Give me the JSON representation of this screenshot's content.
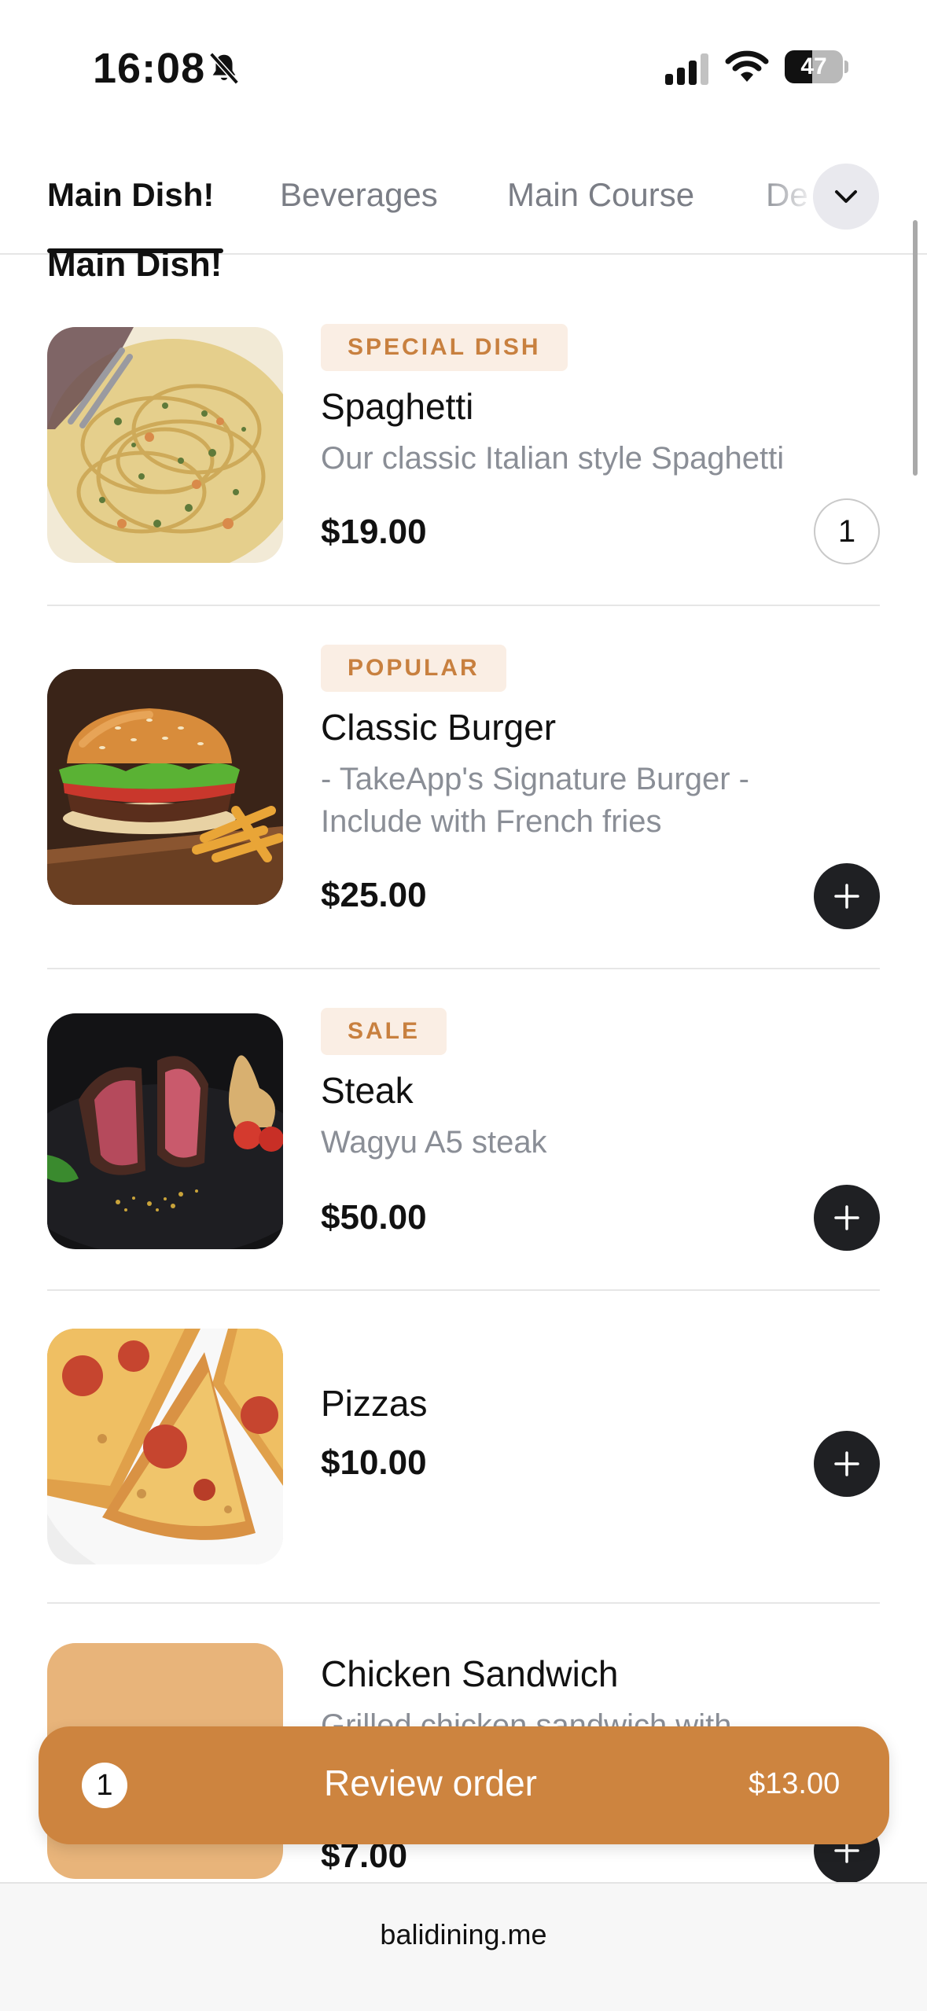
{
  "status_bar": {
    "time": "16:08",
    "battery_level": "47",
    "battery_fraction": 0.47
  },
  "tabs": [
    {
      "label": "Main Dish!",
      "active": true
    },
    {
      "label": "Beverages",
      "active": false
    },
    {
      "label": "Main Course",
      "active": false
    },
    {
      "label": "De",
      "active": false
    }
  ],
  "section_title": "Main Dish!",
  "items": [
    {
      "badge": "SPECIAL DISH",
      "name": "Spaghetti",
      "description": "Our classic Italian style Spaghetti",
      "price": "$19.00",
      "quantity": "1"
    },
    {
      "badge": "POPULAR",
      "name": "Classic Burger",
      "description": "- TakeApp's Signature Burger - Include with French fries",
      "price": "$25.00"
    },
    {
      "badge": "SALE",
      "name": "Steak",
      "description": "Wagyu A5 steak",
      "price": "$50.00"
    },
    {
      "name": "Pizzas",
      "price": "$10.00"
    },
    {
      "name": "Chicken Sandwich",
      "description": "Grilled chicken sandwich with",
      "price": "$7.00"
    }
  ],
  "review_order": {
    "count": "1",
    "label": "Review order",
    "total": "$13.00"
  },
  "browser": {
    "domain": "balidining.me"
  },
  "colors": {
    "accent": "#cd843f",
    "badge_bg": "#faeee4",
    "badge_text": "#c8803f",
    "button_dark": "#1f2023"
  }
}
